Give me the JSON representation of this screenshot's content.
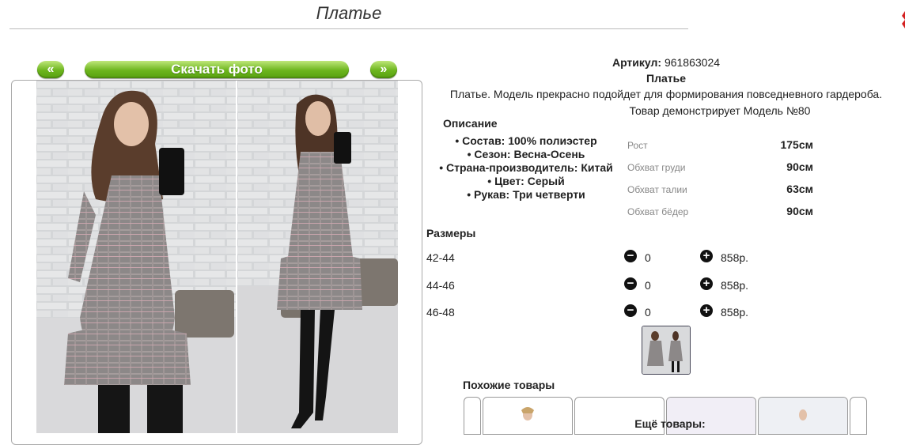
{
  "page": {
    "title": "Платье"
  },
  "gallery": {
    "prev_label": "«",
    "next_label": "»",
    "download_label": "Скачать фото"
  },
  "product": {
    "article_label": "Артикул:",
    "article_value": "961863024",
    "name": "Платье",
    "description": "Платье. Модель прекрасно подойдет для формирования повседневного гардероба.",
    "model_note": "Товар демонстрирует Модель №80",
    "features_heading": "Описание",
    "features": [
      "Состав: 100% полиэстер",
      "Сезон: Весна-Осень",
      "Страна-производитель: Китай",
      "Цвет: Серый",
      "Рукав: Три четверти"
    ],
    "measurements": [
      {
        "label": "Рост",
        "value": "175см"
      },
      {
        "label": "Обхват груди",
        "value": "90см"
      },
      {
        "label": "Обхват талии",
        "value": "63см"
      },
      {
        "label": "Обхват бёдер",
        "value": "90см"
      }
    ]
  },
  "sizes": {
    "heading": "Размеры",
    "minus_symbol": "−",
    "plus_symbol": "+",
    "rows": [
      {
        "size": "42-44",
        "qty": "0",
        "price": "858р."
      },
      {
        "size": "44-46",
        "qty": "0",
        "price": "858р."
      },
      {
        "size": "46-48",
        "qty": "0",
        "price": "858р."
      }
    ]
  },
  "similar": {
    "heading": "Похожие товары"
  },
  "more": {
    "heading": "Ещё товары:"
  },
  "colors": {
    "button_green": "#6cb51d",
    "close_red": "#d42020",
    "dress_gray": "#8a8584"
  }
}
